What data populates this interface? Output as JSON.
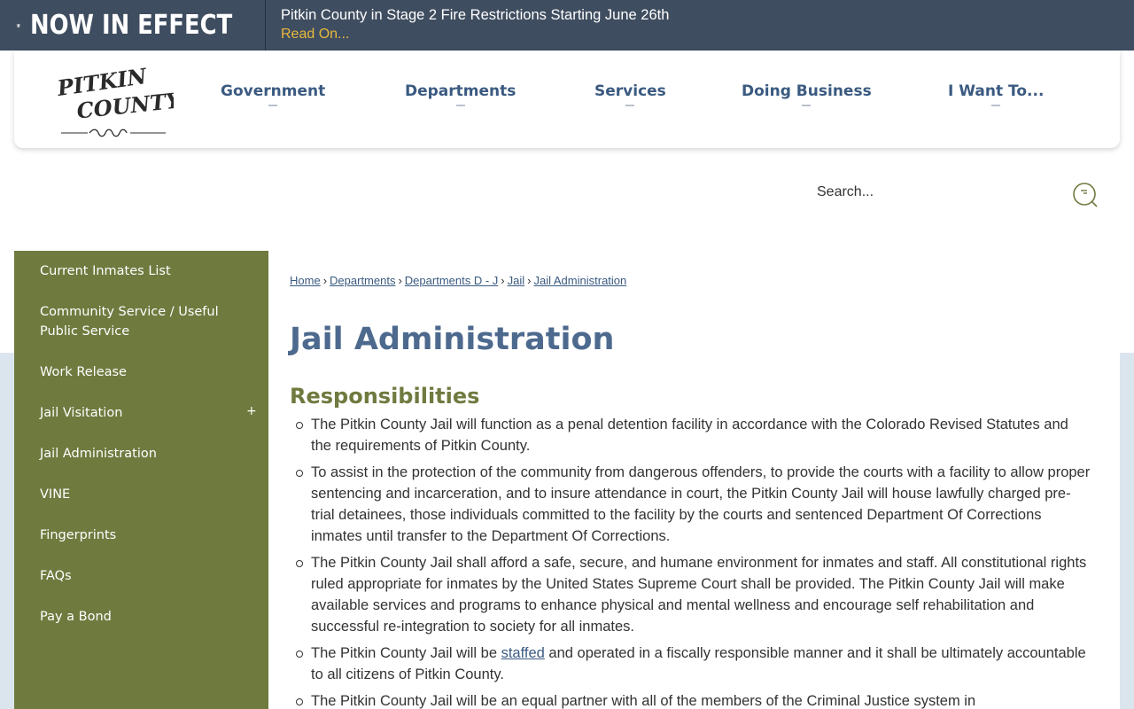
{
  "alert": {
    "title": "NOW IN EFFECT",
    "message": "Pitkin County in Stage 2 Fire Restrictions Starting June 26th",
    "link": "Read On..."
  },
  "logo": {
    "line1": "PITKIN",
    "line2": "COUNTY"
  },
  "nav": [
    "Government",
    "Departments",
    "Services",
    "Doing Business",
    "I Want To..."
  ],
  "search": {
    "placeholder": "Search..."
  },
  "sidebar": {
    "items": [
      "Current Inmates List",
      "Community Service / Useful Public Service",
      "Work Release",
      "Jail Visitation",
      "Jail Administration",
      "VINE",
      "Fingerprints",
      "FAQs",
      "Pay a Bond"
    ],
    "expand_symbol": "+"
  },
  "breadcrumb": [
    "Home",
    "Departments",
    "Departments D - J",
    "Jail",
    "Jail Administration"
  ],
  "breadcrumb_sep": "›",
  "page_title": "Jail Administration",
  "section_heading": "Responsibilities",
  "responsibilities": [
    {
      "text": "The Pitkin County Jail will function as a penal detention facility in accordance with the Colorado Revised Statutes and the requirements of Pitkin County."
    },
    {
      "text": "To assist in the protection of the community from dangerous offenders, to provide the courts with a facility to allow proper sentencing and incarceration, and to insure attendance in court, the Pitkin County Jail will house lawfully charged pre-trial detainees, those individuals committed to the facility by the courts and sentenced Department Of Corrections inmates until transfer to the Department Of Corrections."
    },
    {
      "text": "The Pitkin County Jail shall afford a safe, secure, and humane environment for inmates and staff. All constitutional rights ruled appropriate for inmates by the United States Supreme Court shall be provided. The Pitkin County Jail will make available services and programs to enhance physical and mental wellness and encourage self rehabilitation and successful re-integration to society for all inmates."
    },
    {
      "before": "The Pitkin County Jail will be ",
      "link": "staffed",
      "after": " and operated in a fiscally responsible manner and it shall be ultimately accountable to all citizens of Pitkin County."
    },
    {
      "text": "The Pitkin County Jail will be an equal partner with all of the members of the Criminal Justice system in"
    }
  ],
  "colors": {
    "alert_bg": "#3f4d60",
    "alert_link": "#e8b93c",
    "nav_text": "#3a5a80",
    "sidebar_bg": "#6f7a3f",
    "title": "#4d6a8e",
    "heading": "#6f7a3f"
  }
}
